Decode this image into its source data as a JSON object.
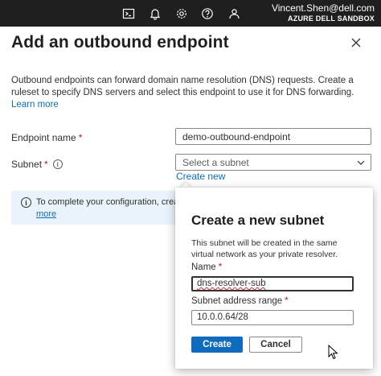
{
  "topbar": {
    "icons": [
      "cloud-shell-icon",
      "notifications-icon",
      "settings-icon",
      "help-icon",
      "feedback-icon"
    ],
    "account_email": "Vincent.Shen@dell.com",
    "account_tenant": "AZURE DELL SANDBOX"
  },
  "panel": {
    "title": "Add an outbound endpoint",
    "description": "Outbound endpoints can forward domain name resolution (DNS) requests. Create a ruleset to specify DNS servers and select this endpoint to use it for DNS forwarding.",
    "learn_more": "Learn more",
    "endpoint_name_label": "Endpoint name",
    "endpoint_name_value": "demo-outbound-endpoint",
    "subnet_label": "Subnet",
    "subnet_placeholder": "Select a subnet",
    "create_new_link": "Create new",
    "info_text": "To complete your configuration, create r",
    "info_more": "more",
    "required_marker": "*"
  },
  "callout": {
    "title": "Create a new subnet",
    "description": "This subnet will be created in the same virtual network as your private resolver.",
    "name_label": "Name",
    "name_value": "dns-resolver-sub",
    "address_label": "Subnet address range",
    "address_value": "10.0.0.64/28",
    "create_button": "Create",
    "cancel_button": "Cancel"
  },
  "colors": {
    "topbar_bg": "#1f1f1f",
    "accent": "#0f6cbd",
    "info_bg": "#eaf3fb",
    "required": "#a4262c"
  }
}
